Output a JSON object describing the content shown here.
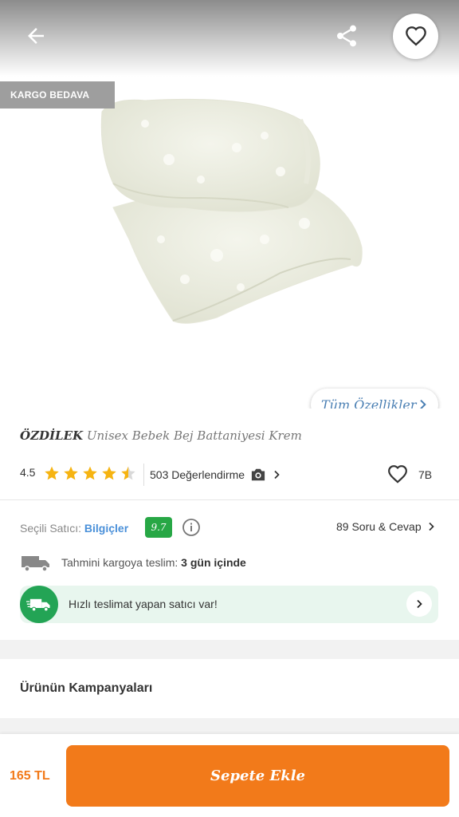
{
  "header": {
    "back_icon": "arrow-left-icon",
    "share_icon": "share-icon",
    "favorite_icon": "heart-outline-icon"
  },
  "badge": {
    "label": "KARGO BEDAVA"
  },
  "specs_button": {
    "label": "Tüm Özellikler"
  },
  "product": {
    "brand": "ÖZDİLEK",
    "name": "Unisex Bebek Bej Battaniyesi Krem",
    "rating": "4.5",
    "rating_value": 4.5,
    "reviews_label": "503 Değerlendirme",
    "favorites_count": "7B"
  },
  "seller": {
    "label": "Seçili Satıcı: ",
    "name": "Bilgiçler",
    "score": "9.7",
    "qa_label": "89 Soru & Cevap"
  },
  "shipping": {
    "label": "Tahmini kargoya teslim: ",
    "value": "3 gün içinde"
  },
  "fast_delivery": {
    "label": "Hızlı teslimat yapan satıcı var!"
  },
  "campaign": {
    "title": "Ürünün Kampanyaları"
  },
  "footer": {
    "price": "165 TL",
    "cart_label": "Sepete Ekle"
  },
  "colors": {
    "accent": "#f27a1a",
    "star": "#f6b412",
    "seller_link": "#4a90d9",
    "score_badge": "#27a745",
    "fast_box_bg": "#e8f6ee"
  }
}
